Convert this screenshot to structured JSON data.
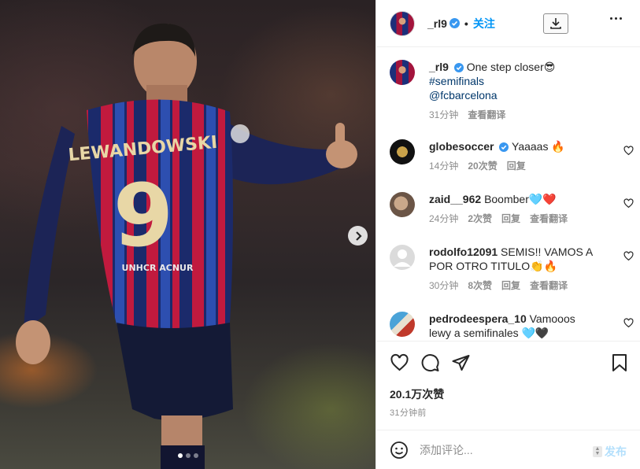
{
  "post": {
    "author": "_rl9",
    "follow_label": "关注",
    "separator": "•",
    "jersey_name": "LEWANDOWSKI",
    "jersey_number": "9",
    "sleeve_patch": "UNHCR ACNUR",
    "carousel": {
      "slides": 3,
      "active": 0
    }
  },
  "caption": {
    "author": "_rl9",
    "text": "One step closer😎",
    "hashtag": "#semifinals",
    "mention": "@fcbarcelona",
    "time": "31分钟",
    "translate": "查看翻译"
  },
  "comments": [
    {
      "user": "globesoccer",
      "verified": true,
      "text": "Yaaaas 🔥",
      "time": "14分钟",
      "likes": "20次赞",
      "reply": "回复",
      "translate": ""
    },
    {
      "user": "zaid__962",
      "verified": false,
      "text": "Boomber🩵❤️",
      "time": "24分钟",
      "likes": "2次赞",
      "reply": "回复",
      "translate": "查看翻译"
    },
    {
      "user": "rodolfo12091",
      "verified": false,
      "text": "SEMIS!! VAMOS A POR OTRO TITULO👏🔥",
      "time": "30分钟",
      "likes": "8次赞",
      "reply": "回复",
      "translate": "查看翻译"
    },
    {
      "user": "pedrodeespera_10",
      "verified": false,
      "text": "Vamooos lewy a semifinales 🩵🖤",
      "time": "",
      "likes": "",
      "reply": "",
      "translate": ""
    }
  ],
  "stats": {
    "likes": "20.1万次赞",
    "posted": "31分钟前"
  },
  "composer": {
    "placeholder": "添加评论...",
    "post_label": "发布"
  },
  "colors": {
    "accent": "#0095f6",
    "verified": "#3897f0",
    "post_disabled": "#b2dffc"
  },
  "icons": [
    "download-icon",
    "more-icon",
    "verified-icon",
    "heart-icon",
    "comment-icon",
    "share-icon",
    "save-icon",
    "emoji-icon",
    "chevron-right-icon"
  ]
}
